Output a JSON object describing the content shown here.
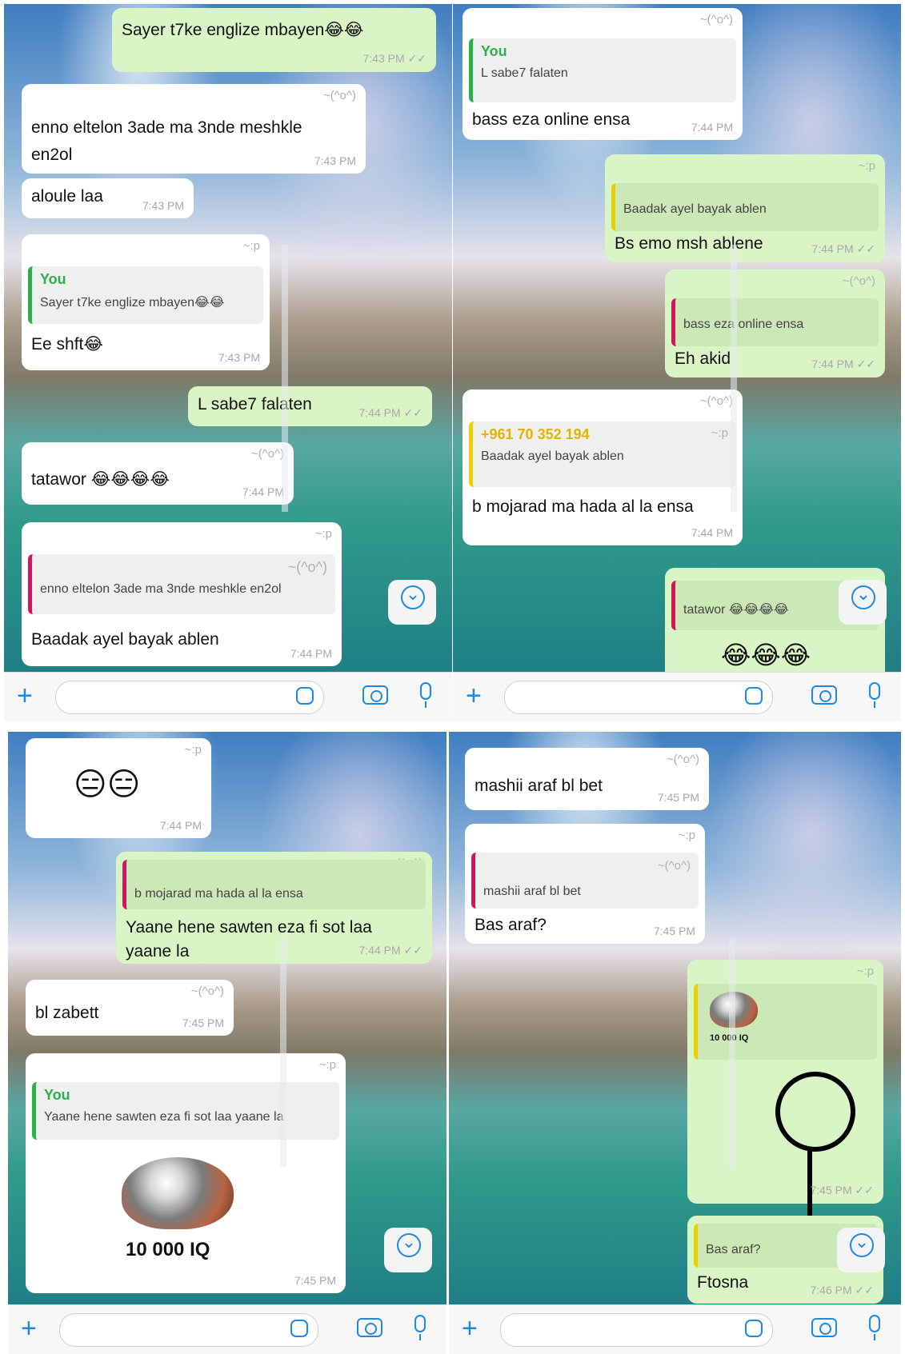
{
  "tl": {
    "b1": {
      "text": "Sayer t7ke englize mbayen😂😂",
      "time": "7:43 PM"
    },
    "b2": {
      "sender": "~(^o^)",
      "text": "enno eltelon 3ade ma 3nde meshkle en2ol",
      "time": "7:43 PM"
    },
    "b3": {
      "text": "aloule laa",
      "time": "7:43 PM"
    },
    "b4": {
      "sender": "~:p",
      "q_name": "You",
      "q_text": "Sayer t7ke englize mbayen😂😂",
      "text": "Ee shft😂",
      "time": "7:43 PM"
    },
    "b5": {
      "text": "L sabe7 falaten",
      "time": "7:44 PM"
    },
    "b6": {
      "sender": "~(^o^)",
      "text": "tatawor 😂😂😂😂",
      "time": "7:44 PM"
    },
    "b7": {
      "sender": "~:p",
      "q_name": "~(^o^)",
      "q_text": "enno eltelon 3ade ma 3nde meshkle en2ol",
      "text": "Baadak ayel bayak ablen",
      "time": "7:44 PM"
    }
  },
  "tr": {
    "b1": {
      "sender": "~(^o^)",
      "q_name": "You",
      "q_text": "L sabe7 falaten",
      "text": "bass eza online ensa",
      "time": "7:44 PM"
    },
    "b2": {
      "sender": "~:p",
      "q_text": "Baadak ayel bayak ablen",
      "text": "Bs emo msh ablene",
      "time": "7:44 PM"
    },
    "b3": {
      "sender": "~(^o^)",
      "q_text": "bass eza online ensa",
      "text": "Eh akid",
      "time": "7:44 PM"
    },
    "b4": {
      "sender": "~(^o^)",
      "q_name": "+961 70 352 194",
      "q_sender": "~:p",
      "q_text": "Baadak ayel bayak ablen",
      "text": "b mojarad ma hada al la ensa",
      "time": "7:44 PM"
    },
    "b5": {
      "q_text": "tatawor 😂😂😂😂",
      "text": "😂😂😂"
    }
  },
  "bl": {
    "b1": {
      "sender": "~:p",
      "text": "😑😑",
      "time": "7:44 PM"
    },
    "b2": {
      "sender": "~(^o^)",
      "q_text": "b mojarad ma hada al la ensa",
      "text": "Yaane hene sawten eza fi sot laa yaane la",
      "time": "7:44 PM"
    },
    "b3": {
      "sender": "~(^o^)",
      "text": "bl zabett",
      "time": "7:45 PM"
    },
    "b4": {
      "sender": "~:p",
      "q_name": "You",
      "q_text": "Yaane hene sawten eza fi sot laa yaane la",
      "iq": "10 000 IQ",
      "time": "7:45 PM"
    }
  },
  "br": {
    "b1": {
      "sender": "~(^o^)",
      "text": "mashii araf bl bet",
      "time": "7:45 PM"
    },
    "b2": {
      "sender": "~:p",
      "q_sender": "~(^o^)",
      "q_text": "mashii araf bl bet",
      "text": "Bas araf?",
      "time": "7:45 PM"
    },
    "b3": {
      "sender": "~:p",
      "iq": "10 000 IQ",
      "time": "7:45 PM"
    },
    "b4": {
      "q_text": "Bas araf?",
      "text": "Ftosna",
      "time": "7:46 PM"
    }
  },
  "colors": {
    "accent": "#1e88e5",
    "outgoing": "#d9f5c6",
    "incoming": "#ffffff"
  },
  "icons": [
    "plus-icon",
    "sticker-icon",
    "camera-icon",
    "microphone-icon",
    "scroll-down-icon"
  ]
}
